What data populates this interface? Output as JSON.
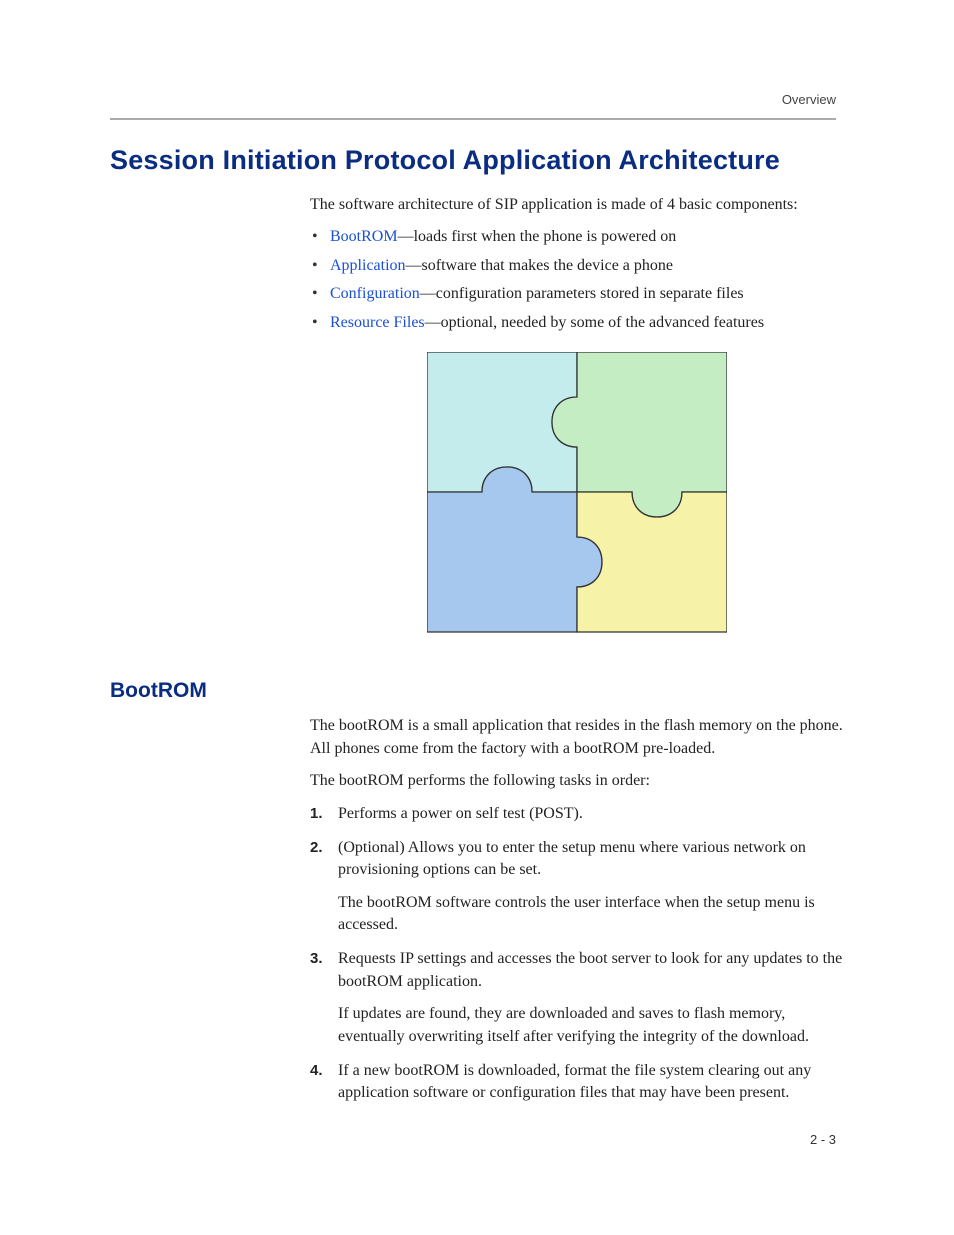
{
  "header": {
    "section_label": "Overview"
  },
  "title": "Session Initiation Protocol Application Architecture",
  "intro": "The software architecture of SIP application is made of 4 basic components:",
  "components": [
    {
      "link": "BootROM",
      "desc": "—loads first when the phone is powered on"
    },
    {
      "link": "Application",
      "desc": "—software that makes the device a phone"
    },
    {
      "link": "Configuration",
      "desc": "—configuration parameters stored in separate files"
    },
    {
      "link": "Resource Files",
      "desc": "—optional, needed by some of the advanced features"
    }
  ],
  "puzzle_colors": {
    "tl": "#c4ecec",
    "tr": "#c4edc4",
    "bl": "#a6c7ee",
    "br": "#f6f3a9"
  },
  "subhead": "BootROM",
  "bootrom_para1": "The bootROM is a small application that resides in the flash memory on the phone. All phones come from the factory with a bootROM pre-loaded.",
  "bootrom_para2": "The bootROM performs the following tasks in order:",
  "steps": [
    {
      "main": "Performs a power on self test (POST)."
    },
    {
      "main": "(Optional) Allows you to enter the setup menu where various network on provisioning options can be set.",
      "sub": "The bootROM software controls the user interface when the setup menu is accessed."
    },
    {
      "main": "Requests IP settings and accesses the boot server to look for any updates to the bootROM application.",
      "sub": "If updates are found, they are downloaded and saves to flash memory, eventually overwriting itself after verifying the integrity of the download."
    },
    {
      "main": "If a new bootROM is downloaded, format the file system clearing out any application software or configuration files that may have been present."
    }
  ],
  "page_number": "2 - 3"
}
